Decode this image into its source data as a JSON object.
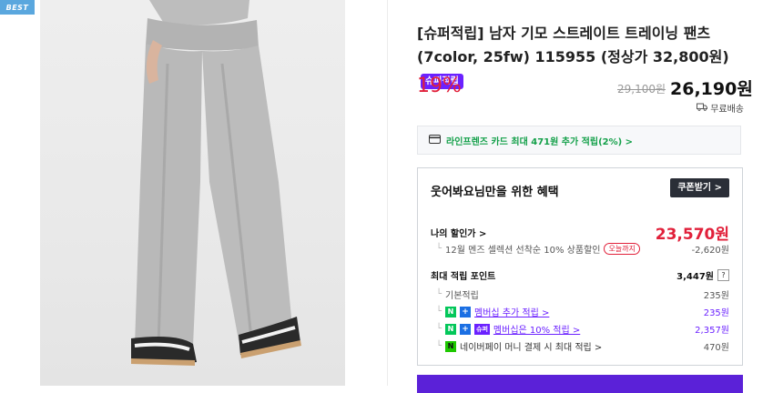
{
  "badge": {
    "best": "BEST"
  },
  "product": {
    "title": "[슈퍼적립] 남자 기모 스트레이트 트레이닝 팬츠 (7color, 25fw) 115955 (정상가 32,800원)",
    "super_badge": "슈퍼적립",
    "discount": "19%",
    "original_price": "29,100원",
    "sale_price": "26,190원",
    "shipping": "무료배송"
  },
  "card_promo": {
    "text": "라인프렌즈 카드 최대 471원 추가 적립(2%) >"
  },
  "benefits": {
    "title": "웃어봐요님만을 위한 혜택",
    "coupon_button": "쿠폰받기 >",
    "my_price_label": "나의 할인가 >",
    "my_price_value": "23,570원",
    "selection_text": "12월 멘즈 셀렉션 선착순 10% 상품할인",
    "today_badge": "오늘까지",
    "selection_value": "-2,620원",
    "max_point_label": "최대 적립 포인트",
    "max_point_value": "3,447원",
    "help_icon": "?",
    "base_label": "기본적립",
    "base_value": "235원",
    "member_extra_label": "멤버십 추가 적립 >",
    "member_extra_value": "235원",
    "super_badge": "슈퍼",
    "member_super_label": "멤버십은 10% 적립 >",
    "member_super_value": "2,357원",
    "npay_label": "네이버페이 머니 결제 시 최대 적립 >",
    "npay_value": "470원"
  },
  "icons": {
    "shipping": "truck-icon",
    "card": "credit-card-icon",
    "naver": "N",
    "plus": "+",
    "npay": "N"
  },
  "colors": {
    "accent_red": "#e1203a",
    "accent_purple": "#6b21ff",
    "card_green": "#14a04a",
    "best_blue": "#5aa7de"
  }
}
